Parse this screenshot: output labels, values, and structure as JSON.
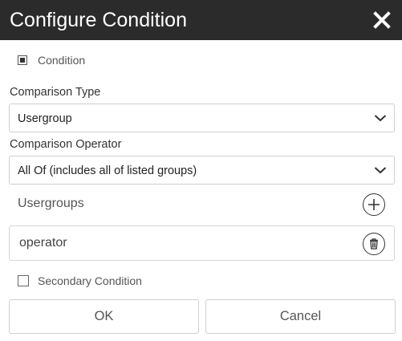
{
  "dialog": {
    "title": "Configure Condition",
    "close_icon": "close-icon"
  },
  "condition": {
    "label": "Condition",
    "checked": true
  },
  "comparison_type": {
    "label": "Comparison Type",
    "selected": "Usergroup",
    "icon": "chevron-down-icon"
  },
  "comparison_operator": {
    "label": "Comparison Operator",
    "selected": "All Of (includes all of listed groups)",
    "icon": "chevron-down-icon"
  },
  "usergroups": {
    "label": "Usergroups",
    "add_icon": "plus-circle-icon",
    "items": [
      {
        "name": "operator",
        "delete_icon": "trash-icon"
      }
    ]
  },
  "secondary_condition": {
    "label": "Secondary Condition",
    "checked": false
  },
  "buttons": {
    "ok": "OK",
    "cancel": "Cancel"
  }
}
